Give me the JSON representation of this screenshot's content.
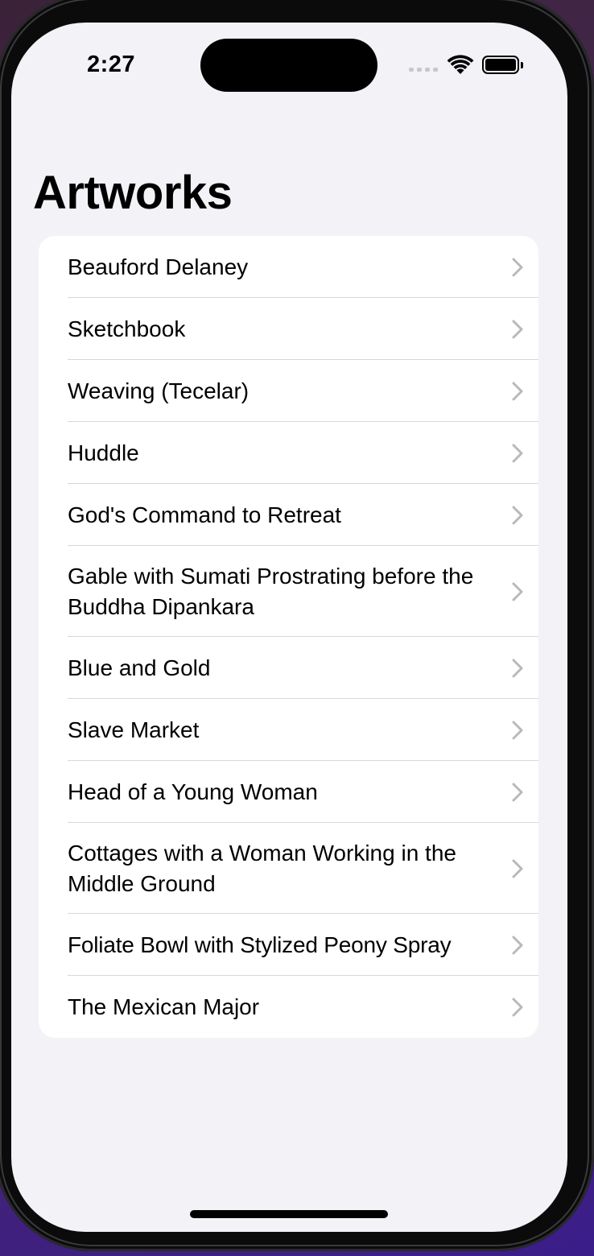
{
  "status_bar": {
    "time": "2:27",
    "signal_icon": "cellular-signal-icon",
    "wifi_icon": "wifi-icon",
    "battery_icon": "battery-icon",
    "battery_level": 1.0
  },
  "nav": {
    "title": "Artworks"
  },
  "list": {
    "chevron_icon": "chevron-right-icon",
    "items": [
      {
        "label": "Beauford Delaney"
      },
      {
        "label": "Sketchbook"
      },
      {
        "label": "Weaving (Tecelar)"
      },
      {
        "label": "Huddle"
      },
      {
        "label": "God's Command to Retreat"
      },
      {
        "label": "Gable with Sumati Prostrating before the Buddha Dipankara"
      },
      {
        "label": "Blue and Gold"
      },
      {
        "label": "Slave Market"
      },
      {
        "label": "Head of a Young Woman"
      },
      {
        "label": "Cottages with a Woman Working in the Middle Ground"
      },
      {
        "label": "Foliate Bowl with Stylized Peony Spray"
      },
      {
        "label": "The Mexican Major"
      }
    ]
  }
}
